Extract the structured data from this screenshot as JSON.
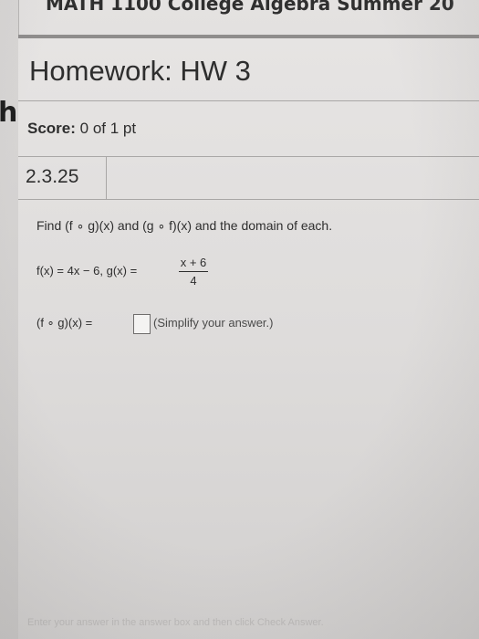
{
  "course": {
    "title": "MATH 1100 College Algebra Summer 20"
  },
  "homework": {
    "title": "Homework: HW 3"
  },
  "score": {
    "label": "Score:",
    "value": "0 of 1 pt"
  },
  "question": {
    "number": "2.3.25",
    "prompt": "Find (f ∘ g)(x) and (g ∘ f)(x) and the domain of each.",
    "functions_text": "f(x) = 4x − 6, g(x) =",
    "fraction": {
      "numerator": "x + 6",
      "denominator": "4"
    },
    "answer_label": "(f ∘ g)(x) =",
    "answer_value": "",
    "hint": "(Simplify your answer.)"
  },
  "footer": {
    "text": "Enter your answer in the answer box and then click Check Answer."
  },
  "left_tab": {
    "glyph": "h"
  }
}
